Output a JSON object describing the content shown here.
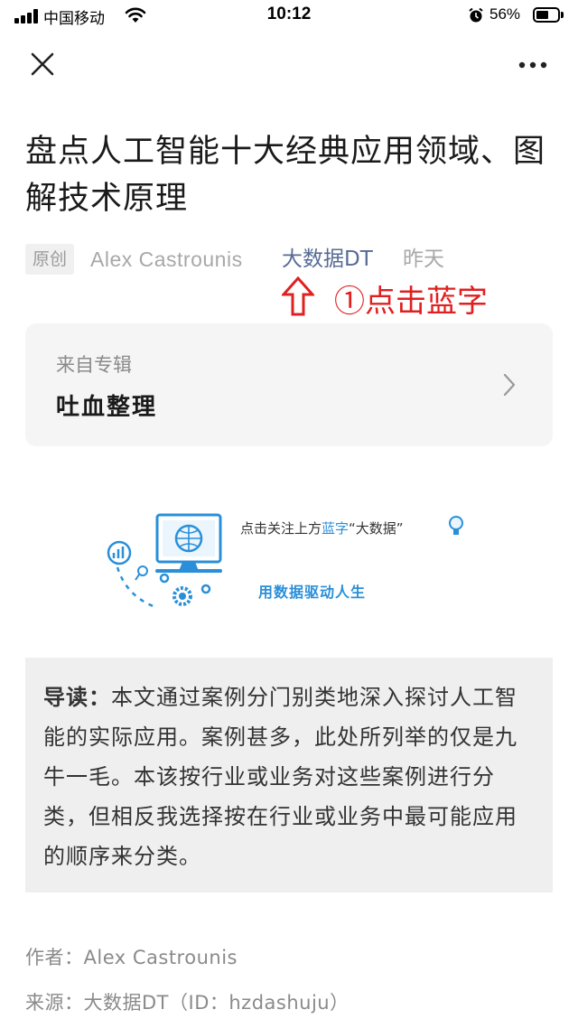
{
  "status_bar": {
    "carrier": "中国移动",
    "time": "10:12",
    "battery_percent": "56%",
    "battery_level": 0.56
  },
  "nav": {
    "close_icon": "close-icon",
    "more_icon": "more-icon"
  },
  "article": {
    "title": "盘点人工智能十大经典应用领域、图解技术原理",
    "badge": "原创",
    "author": "Alex Castrounis",
    "account": "大数据DT",
    "date": "昨天"
  },
  "annotation": {
    "text": "①点击蓝字",
    "color": "#e02020"
  },
  "album": {
    "label": "来自专辑",
    "name": "吐血整理"
  },
  "banner": {
    "tagline_prefix": "点击关注上方",
    "tagline_highlight": "蓝字",
    "tagline_suffix": "“大数据”",
    "slogan": "用数据驱动人生"
  },
  "intro": {
    "lead": "导读：",
    "body": "本文通过案例分门别类地深入探讨人工智能的实际应用。案例甚多，此处所列举的仅是九牛一毛。本该按行业或业务对这些案例进行分类，但相反我选择按在行业或业务中最可能应用的顺序来分类。"
  },
  "meta_lines": {
    "author_line": "作者：Alex Castrounis",
    "source_line": "来源：大数据DT（ID：hzdashuju）"
  },
  "colors": {
    "link_blue": "#576b95",
    "banner_blue": "#2a8fd8"
  }
}
